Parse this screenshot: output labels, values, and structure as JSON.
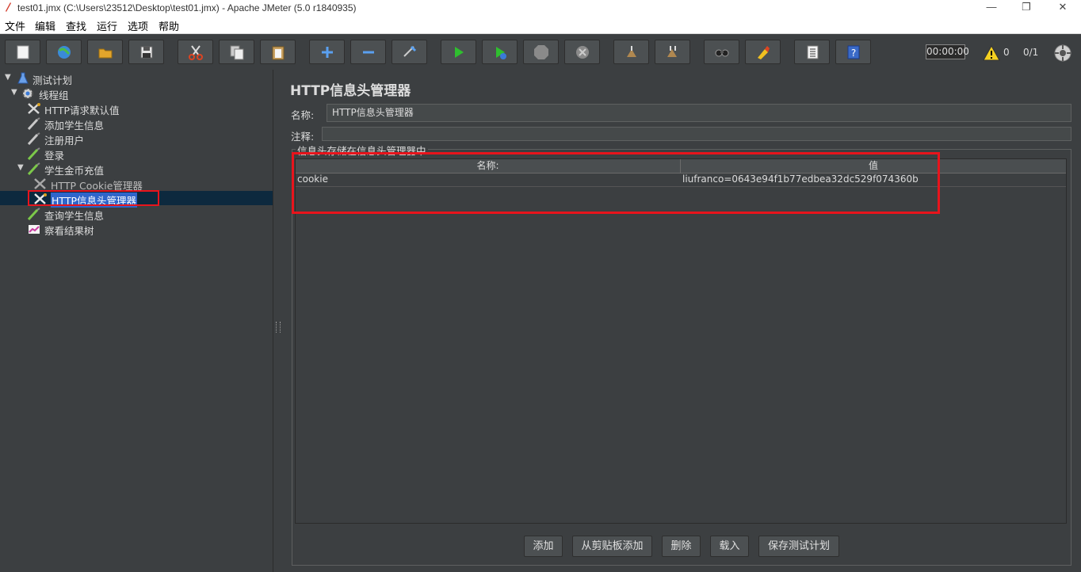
{
  "window": {
    "title": "test01.jmx (C:\\Users\\23512\\Desktop\\test01.jmx) - Apache JMeter (5.0 r1840935)",
    "minimize": "—",
    "restore": "❐",
    "close": "✕"
  },
  "menu": {
    "items": [
      {
        "label": "文件"
      },
      {
        "label": "编辑"
      },
      {
        "label": "查找"
      },
      {
        "label": "运行"
      },
      {
        "label": "选项"
      },
      {
        "label": "帮助"
      }
    ]
  },
  "toolbar": {
    "timer": "00:00:00",
    "warning_count": "0",
    "threads": "0/1",
    "buttons": [
      "new-icon",
      "templates-icon",
      "open-icon",
      "save-icon",
      "cut-icon",
      "copy-icon",
      "paste-icon",
      "expand-icon",
      "collapse-icon",
      "toggle-icon",
      "start-icon",
      "start-no-pauses-icon",
      "stop-icon",
      "shutdown-icon",
      "clear-icon",
      "clear-all-icon",
      "search-icon",
      "reset-search-icon",
      "function-helper-icon",
      "help-icon"
    ]
  },
  "tree": {
    "items": [
      {
        "label": "测试计划",
        "icon": "flask-icon"
      },
      {
        "label": "线程组",
        "icon": "gear-icon"
      },
      {
        "label": "HTTP请求默认值",
        "icon": "wrench-icon"
      },
      {
        "label": "添加学生信息",
        "icon": "pipette-icon"
      },
      {
        "label": "注册用户",
        "icon": "pipette-icon"
      },
      {
        "label": "登录",
        "icon": "pipette-icon"
      },
      {
        "label": "学生金币充值",
        "icon": "pipette-icon"
      },
      {
        "label": "HTTP Cookie管理器",
        "icon": "wrench-icon"
      },
      {
        "label": "HTTP信息头管理器",
        "icon": "wrench-icon"
      },
      {
        "label": "查询学生信息",
        "icon": "pipette-icon"
      },
      {
        "label": "察看结果树",
        "icon": "chart-icon"
      }
    ]
  },
  "panel": {
    "title": "HTTP信息头管理器",
    "name_label": "名称:",
    "name_value": "HTTP信息头管理器",
    "comment_label": "注释:",
    "comment_value": "",
    "group_label": "信息头存储在信息头管理器中",
    "table": {
      "columns": [
        "名称:",
        "值"
      ],
      "rows": [
        {
          "name": "cookie",
          "value": "liufranco=0643e94f1b77edbea32dc529f074360b"
        }
      ]
    },
    "buttons": {
      "add": "添加",
      "add_from_clipboard": "从剪贴板添加",
      "delete": "删除",
      "load": "载入",
      "save_test_plan": "保存测试计划"
    }
  },
  "colors": {
    "background": "#3c3f41",
    "highlight": "#e8141c",
    "selection": "#2f65ca"
  }
}
